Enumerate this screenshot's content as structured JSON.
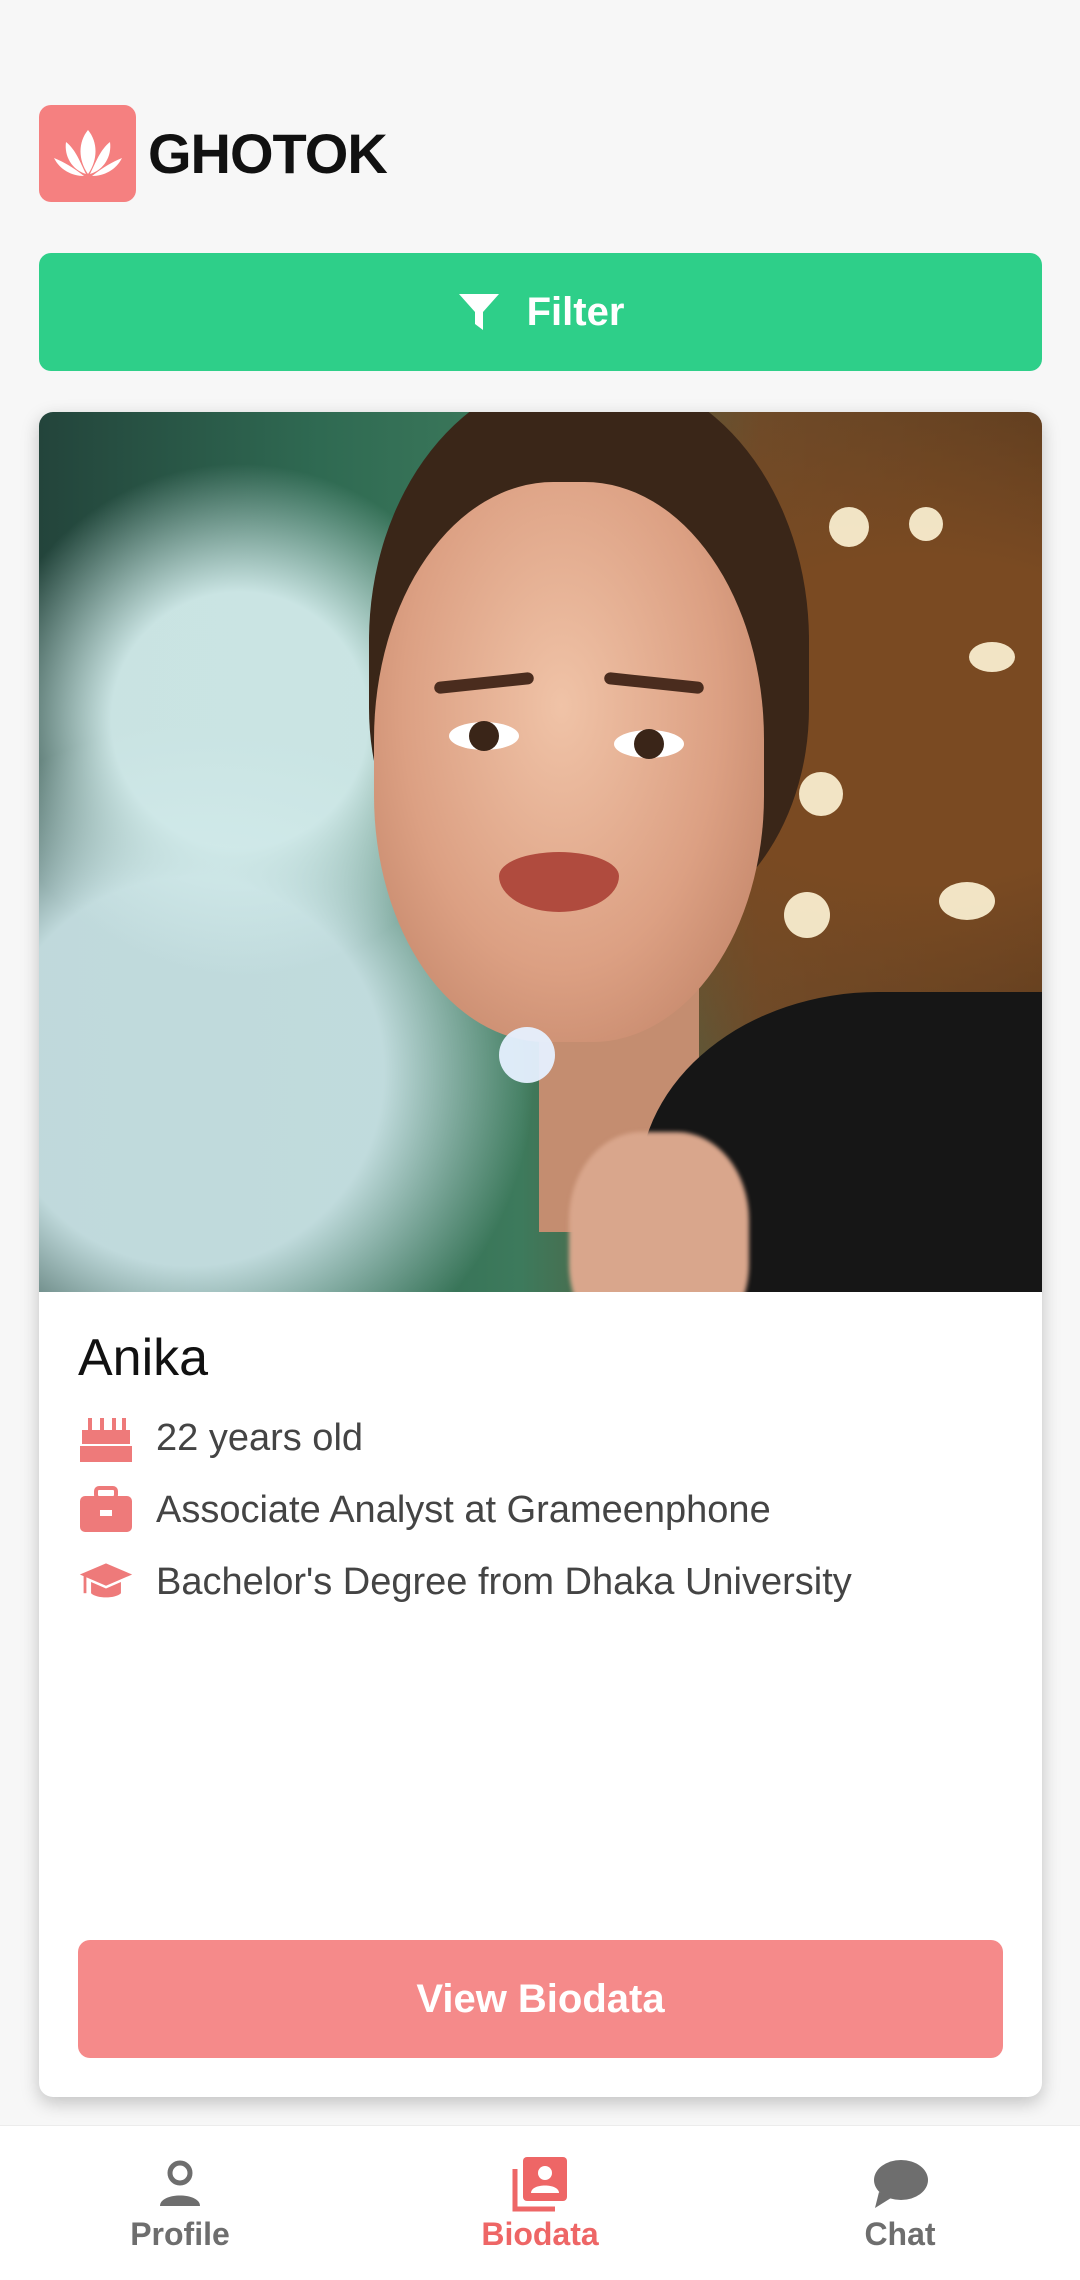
{
  "app": {
    "brand": "GHOTOK",
    "logo_icon": "lotus-icon"
  },
  "filter": {
    "label": "Filter",
    "icon": "funnel-icon",
    "color": "#2ecf89"
  },
  "profile_card": {
    "name": "Anika",
    "details": [
      {
        "icon": "cake-icon",
        "text": "22 years old"
      },
      {
        "icon": "briefcase-icon",
        "text": "Associate Analyst at Grameenphone"
      },
      {
        "icon": "graduation-cap-icon",
        "text": "Bachelor's Degree from Dhaka University"
      }
    ],
    "view_button": "View Biodata",
    "accent": "#f58a8a"
  },
  "bottom_nav": {
    "items": [
      {
        "label": "Profile",
        "icon": "person-icon",
        "active": false
      },
      {
        "label": "Biodata",
        "icon": "biodata-icon",
        "active": true
      },
      {
        "label": "Chat",
        "icon": "chat-bubble-icon",
        "active": false
      }
    ],
    "active_color": "#ee6666",
    "inactive_color": "#6e6e6e"
  }
}
